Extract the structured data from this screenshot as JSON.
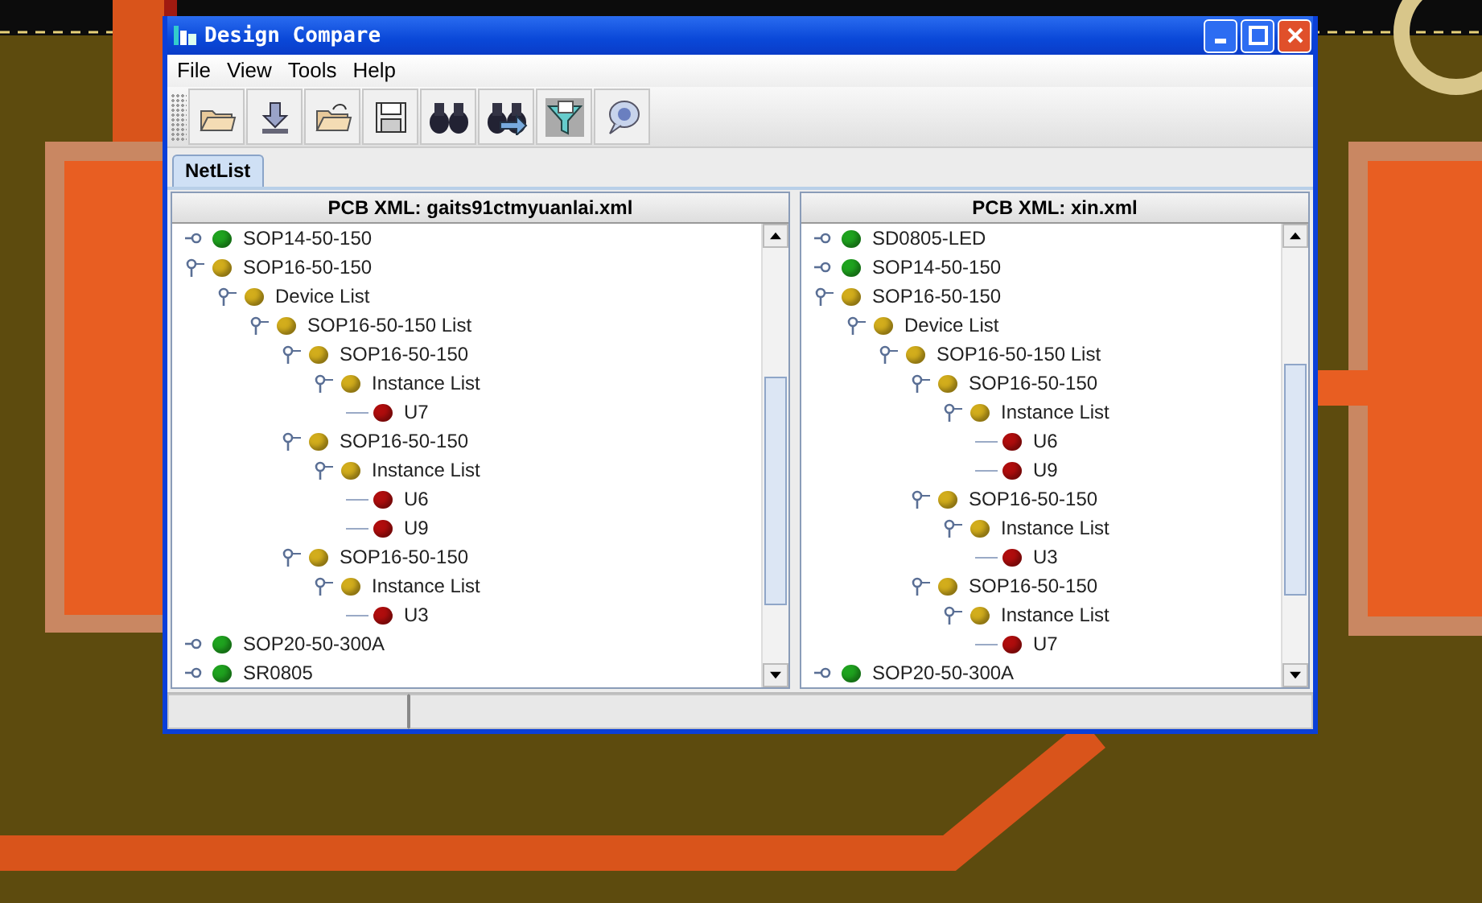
{
  "window": {
    "title": "Design Compare"
  },
  "menu": [
    "File",
    "View",
    "Tools",
    "Help"
  ],
  "tabs": [
    {
      "label": "NetList",
      "selected": true
    }
  ],
  "panels": [
    {
      "title": "PCB XML: gaits91ctmyuanlai.xml",
      "items": [
        {
          "label": "SOP14-50-150",
          "color": "#1fa31f",
          "expanded": false
        },
        {
          "label": "SOP16-50-150",
          "color": "#d2ad1c",
          "expanded": true,
          "children": [
            {
              "label": "Device List",
              "color": "#d2ad1c",
              "expanded": true,
              "children": [
                {
                  "label": "SOP16-50-150 List",
                  "color": "#d2ad1c",
                  "expanded": true,
                  "children": [
                    {
                      "label": "SOP16-50-150",
                      "color": "#d2ad1c",
                      "expanded": true,
                      "children": [
                        {
                          "label": "Instance List",
                          "color": "#d2ad1c",
                          "expanded": true,
                          "children": [
                            {
                              "label": "U7",
                              "color": "#b00d0d"
                            }
                          ]
                        }
                      ]
                    },
                    {
                      "label": "SOP16-50-150",
                      "color": "#d2ad1c",
                      "expanded": true,
                      "children": [
                        {
                          "label": "Instance List",
                          "color": "#d2ad1c",
                          "expanded": true,
                          "children": [
                            {
                              "label": "U6",
                              "color": "#b00d0d"
                            },
                            {
                              "label": "U9",
                              "color": "#b00d0d"
                            }
                          ]
                        }
                      ]
                    },
                    {
                      "label": "SOP16-50-150",
                      "color": "#d2ad1c",
                      "expanded": true,
                      "children": [
                        {
                          "label": "Instance List",
                          "color": "#d2ad1c",
                          "expanded": true,
                          "children": [
                            {
                              "label": "U3",
                              "color": "#b00d0d"
                            }
                          ]
                        }
                      ]
                    }
                  ]
                }
              ]
            }
          ]
        },
        {
          "label": "SOP20-50-300A",
          "color": "#1fa31f",
          "expanded": false
        },
        {
          "label": "SR0805",
          "color": "#1fa31f",
          "expanded": false
        }
      ]
    },
    {
      "title": "PCB XML: xin.xml",
      "items": [
        {
          "label": "SD0805-LED",
          "color": "#1fa31f",
          "expanded": false
        },
        {
          "label": "SOP14-50-150",
          "color": "#1fa31f",
          "expanded": false
        },
        {
          "label": "SOP16-50-150",
          "color": "#d2ad1c",
          "expanded": true,
          "children": [
            {
              "label": "Device List",
              "color": "#d2ad1c",
              "expanded": true,
              "children": [
                {
                  "label": "SOP16-50-150 List",
                  "color": "#d2ad1c",
                  "expanded": true,
                  "children": [
                    {
                      "label": "SOP16-50-150",
                      "color": "#d2ad1c",
                      "expanded": true,
                      "children": [
                        {
                          "label": "Instance List",
                          "color": "#d2ad1c",
                          "expanded": true,
                          "children": [
                            {
                              "label": "U6",
                              "color": "#b00d0d"
                            },
                            {
                              "label": "U9",
                              "color": "#b00d0d"
                            }
                          ]
                        }
                      ]
                    },
                    {
                      "label": "SOP16-50-150",
                      "color": "#d2ad1c",
                      "expanded": true,
                      "children": [
                        {
                          "label": "Instance List",
                          "color": "#d2ad1c",
                          "expanded": true,
                          "children": [
                            {
                              "label": "U3",
                              "color": "#b00d0d"
                            }
                          ]
                        }
                      ]
                    },
                    {
                      "label": "SOP16-50-150",
                      "color": "#d2ad1c",
                      "expanded": true,
                      "children": [
                        {
                          "label": "Instance List",
                          "color": "#d2ad1c",
                          "expanded": true,
                          "children": [
                            {
                              "label": "U7",
                              "color": "#b00d0d"
                            }
                          ]
                        }
                      ]
                    }
                  ]
                }
              ]
            }
          ]
        },
        {
          "label": "SOP20-50-300A",
          "color": "#1fa31f",
          "expanded": false
        }
      ]
    }
  ]
}
